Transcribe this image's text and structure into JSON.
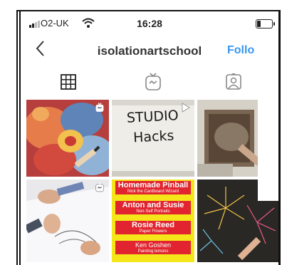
{
  "status_bar": {
    "carrier": "O2-UK",
    "time": "16:28"
  },
  "header": {
    "username": "isolationartschool",
    "follow_label": "Follo",
    "back_icon": "chevron-left-icon"
  },
  "tabs": [
    {
      "name": "grid-icon",
      "active": true
    },
    {
      "name": "igtv-icon",
      "active": false
    },
    {
      "name": "tagged-icon",
      "active": false
    }
  ],
  "posts": {
    "studio_hacks_text": "STUDIO Hacks",
    "poster": {
      "items": [
        {
          "title": "Homemade Pinball",
          "subtitle": "Nick the Cardboard Wizard"
        },
        {
          "title": "Anton and Susie",
          "subtitle": "Non-Self Portraits"
        },
        {
          "title": "Rosie Reed",
          "subtitle": "Paper Flowers"
        },
        {
          "title": "Ken Goshen",
          "subtitle": "Painting lemons"
        }
      ]
    }
  },
  "colors": {
    "accent": "#3897f0",
    "poster_yellow": "#f5e619",
    "poster_red": "#e1242f"
  }
}
